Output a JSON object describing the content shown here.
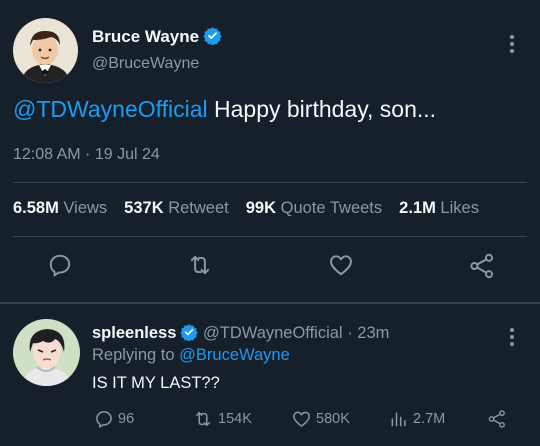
{
  "tweet": {
    "author_name": "Bruce Wayne",
    "author_handle": "@BruceWayne",
    "text_mention": "@TDWayneOfficial",
    "text_body": " Happy birthday, son...",
    "timestamp": "12:08 AM · 19 Jul 24",
    "stats": [
      {
        "value": "6.58M",
        "label": "Views"
      },
      {
        "value": "537K",
        "label": "Retweet"
      },
      {
        "value": "99K",
        "label": "Quote Tweets"
      },
      {
        "value": "2.1M",
        "label": "Likes"
      }
    ]
  },
  "reply": {
    "author_name": "spleenless",
    "author_handle": "@TDWayneOfficial",
    "time": "23m",
    "replying_label": "Replying to",
    "replying_to": "@BruceWayne",
    "text": "IS IT MY LAST??",
    "counts": {
      "replies": "96",
      "retweets": "154K",
      "likes": "580K",
      "views": "2.7M"
    }
  },
  "colors": {
    "background": "#15202b",
    "accent": "#1d9bf0",
    "muted": "#8b98a5",
    "text": "#f7f9f9",
    "divider": "#38444d"
  },
  "icons": [
    "verified-badge-icon",
    "more-icon",
    "reply-icon",
    "retweet-icon",
    "like-icon",
    "share-icon",
    "views-icon"
  ]
}
